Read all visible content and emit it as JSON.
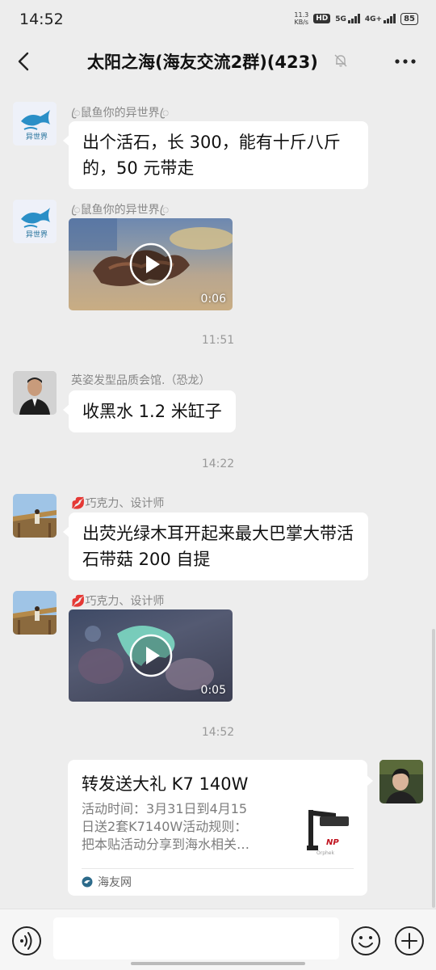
{
  "status_bar": {
    "time": "14:52",
    "net_speed_value": "11.3",
    "net_speed_unit": "KB/s",
    "hd": "HD",
    "sig_5g": "5G",
    "sig_4g": "4G+",
    "battery": "85"
  },
  "header": {
    "title": "太阳之海(海友交流2群)(423)",
    "icons": [
      "back-icon",
      "mute-bell-icon",
      "more-icon"
    ]
  },
  "messages": [
    {
      "sender": "鼠鱼你的异世界",
      "sender_decoration": "ꦿ",
      "avatar": "fish-logo",
      "type": "text",
      "text": "出个活石，长 300，能有十斤八斤的，50 元带走"
    },
    {
      "sender": "鼠鱼你的异世界",
      "sender_decoration": "ꦿ",
      "avatar": "fish-logo",
      "type": "video",
      "duration": "0:06"
    },
    {
      "timestamp": "11:51"
    },
    {
      "sender": "英姿发型品质会馆.（恐龙）",
      "avatar": "man-portrait",
      "type": "text",
      "text": "收黑水 1.2 米缸子"
    },
    {
      "timestamp": "14:22"
    },
    {
      "sender": "巧克力、设计师",
      "sender_decoration": "💋",
      "avatar": "landscape-photo",
      "type": "text",
      "text": "出荧光绿木耳开起来最大巴掌大带活石带菇 200 自提"
    },
    {
      "sender": "巧克力、设计师",
      "sender_decoration": "💋",
      "avatar": "landscape-photo",
      "type": "video",
      "duration": "0:05"
    },
    {
      "timestamp": "14:52"
    }
  ],
  "link_card": {
    "title": "转发送大礼 K7 140W",
    "desc_lines": [
      "活动时间：3月31日到4月15",
      "日送2套K7140W活动规则：",
      "把本贴活动分享到海水相关…"
    ],
    "source": "海友网",
    "thumb_mark": "NP",
    "thumb_brand": "Orphek"
  },
  "input_bar": {
    "placeholder": "",
    "icons": [
      "voice-icon",
      "emoji-icon",
      "plus-icon"
    ]
  },
  "colors": {
    "background": "#ededed",
    "bubble": "#ffffff",
    "meta_text": "#888888",
    "accent_red": "#c0121e"
  }
}
